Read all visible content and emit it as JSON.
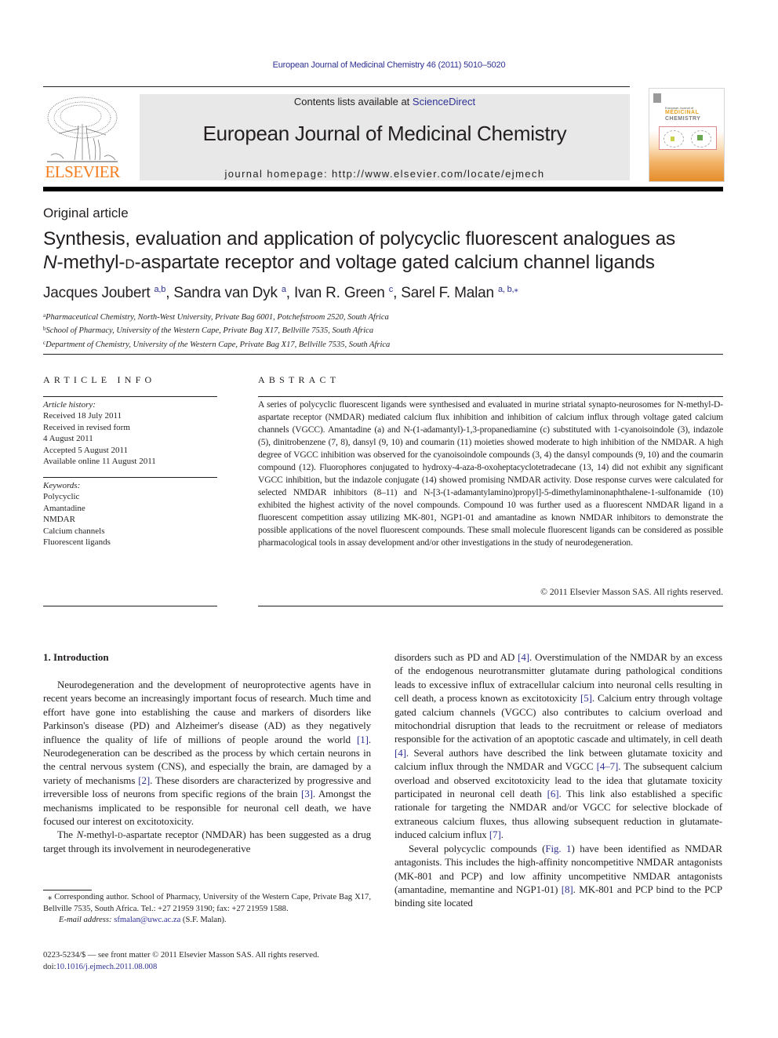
{
  "header": {
    "journal_ref": "European Journal of Medicinal Chemistry 46 (2011) 5010–5020",
    "contents_prefix": "Contents lists available at ",
    "contents_link": "ScienceDirect",
    "journal_title": "European Journal of Medicinal Chemistry",
    "homepage": "journal homepage: http://www.elsevier.com/locate/ejmech",
    "publisher_logo_text": "ELSEVIER",
    "cover": {
      "line1": "European Journal of",
      "line2": "MEDICINAL",
      "line3": "CHEMISTRY"
    }
  },
  "article": {
    "type": "Original article",
    "title_line1": "Synthesis, evaluation and application of polycyclic fluorescent analogues as",
    "title_line2_prefix": "N",
    "title_line2_mid": "-methyl-",
    "title_line2_d": "d",
    "title_line2_rest": "-aspartate receptor and voltage gated calcium channel ligands",
    "authors": [
      {
        "name": "Jacques Joubert",
        "sup": "a,b",
        "sep": ", "
      },
      {
        "name": "Sandra van Dyk",
        "sup": "a",
        "sep": ", "
      },
      {
        "name": "Ivan R. Green",
        "sup": "c",
        "sep": ", "
      },
      {
        "name": "Sarel F. Malan",
        "sup": "a, b,⁎",
        "sep": ""
      }
    ],
    "affiliations": [
      {
        "mark": "a",
        "text": "Pharmaceutical Chemistry, North-West University, Private Bag 6001, Potchefstroom 2520, South Africa"
      },
      {
        "mark": "b",
        "text": "School of Pharmacy, University of the Western Cape, Private Bag X17, Bellville 7535, South Africa"
      },
      {
        "mark": "c",
        "text": "Department of Chemistry, University of the Western Cape, Private Bag X17, Bellville 7535, South Africa"
      }
    ]
  },
  "article_info": {
    "heading": "ARTICLE INFO",
    "history_label": "Article history:",
    "history": [
      "Received 18 July 2011",
      "Received in revised form",
      "4 August 2011",
      "Accepted 5 August 2011",
      "Available online 11 August 2011"
    ],
    "keywords_label": "Keywords:",
    "keywords": [
      "Polycyclic",
      "Amantadine",
      "NMDAR",
      "Calcium channels",
      "Fluorescent ligands"
    ]
  },
  "abstract": {
    "heading": "ABSTRACT",
    "text": "A series of polycyclic fluorescent ligands were synthesised and evaluated in murine striatal synapto-neurosomes for N-methyl-D-aspartate receptor (NMDAR) mediated calcium flux inhibition and inhibition of calcium influx through voltage gated calcium channels (VGCC). Amantadine (a) and N-(1-adamantyl)-1,3-propanediamine (c) substituted with 1-cyanoisoindole (3), indazole (5), dinitrobenzene (7, 8), dansyl (9, 10) and coumarin (11) moieties showed moderate to high inhibition of the NMDAR. A high degree of VGCC inhibition was observed for the cyanoisoindole compounds (3, 4) the dansyl compounds (9, 10) and the coumarin compound (12). Fluorophores conjugated to hydroxy-4-aza-8-oxoheptacyclotetradecane (13, 14) did not exhibit any significant VGCC inhibition, but the indazole conjugate (14) showed promising NMDAR activity. Dose response curves were calculated for selected NMDAR inhibitors (8–11) and N-[3-(1-adamantylamino)propyl]-5-dimethylaminonaphthalene-1-sulfonamide (10) exhibited the highest activity of the novel compounds. Compound 10 was further used as a fluorescent NMDAR ligand in a fluorescent competition assay utilizing MK-801, NGP1-01 and amantadine as known NMDAR inhibitors to demonstrate the possible applications of the novel fluorescent compounds. These small molecule fluorescent ligands can be considered as possible pharmacological tools in assay development and/or other investigations in the study of neurodegeneration.",
    "copyright": "© 2011 Elsevier Masson SAS. All rights reserved."
  },
  "body": {
    "section_heading": "1.  Introduction",
    "left_p1": [
      "Neurodegeneration and the development of neuroprotective agents have in recent years become an increasingly important focus of research. Much time and effort have gone into establishing the cause and markers of disorders like Parkinson's disease (PD) and Alzheimer's disease (AD) as they negatively influence the quality of life of millions of people around the world ",
      "[1]",
      ". Neurodegeneration can be described as the process by which certain neurons in the central nervous system (CNS), and especially the brain, are damaged by a variety of mechanisms ",
      "[2]",
      ". These disorders are characterized by progressive and irreversible loss of neurons from specific regions of the brain ",
      "[3]",
      ". Amongst the mechanisms implicated to be responsible for neuronal cell death, we have focused our interest on excitotoxicity."
    ],
    "left_p2_a": "The ",
    "left_p2_n": "N",
    "left_p2_b": "-methyl-",
    "left_p2_d": "d",
    "left_p2_c": "-aspartate receptor (NMDAR) has been suggested as a drug target through its involvement in neurodegenerative",
    "right_p1": [
      "disorders such as PD and AD ",
      "[4]",
      ". Overstimulation of the NMDAR by an excess of the endogenous neurotransmitter glutamate during pathological conditions leads to excessive influx of extracellular calcium into neuronal cells resulting in cell death, a process known as excitotoxicity ",
      "[5]",
      ". Calcium entry through voltage gated calcium channels (VGCC) also contributes to calcium overload and mitochondrial disruption that leads to the recruitment or release of mediators responsible for the activation of an apoptotic cascade and ultimately, in cell death ",
      "[4]",
      ". Several authors have described the link between glutamate toxicity and calcium influx through the NMDAR and VGCC ",
      "[4–7]",
      ". The subsequent calcium overload and observed excitotoxicity lead to the idea that glutamate toxicity participated in neuronal cell death ",
      "[6]",
      ". This link also established a specific rationale for targeting the NMDAR and/or VGCC for selective blockade of extraneous calcium fluxes, thus allowing subsequent reduction in glutamate-induced calcium influx ",
      "[7]",
      "."
    ],
    "right_p2": [
      "Several polycyclic compounds (",
      "Fig. 1",
      ") have been identified as NMDAR antagonists. This includes the high-affinity noncompetitive NMDAR antagonists (MK-801 and PCP) and low affinity uncompetitive NMDAR antagonists (amantadine, memantine and NGP1-01) ",
      "[8]",
      ". MK-801 and PCP bind to the PCP binding site located"
    ]
  },
  "footnote": {
    "corresponding": "⁎ Corresponding author. School of Pharmacy, University of the Western Cape, Private Bag X17, Bellville 7535, South Africa. Tel.: +27 21959 3190; fax: +27 21959 1588.",
    "email_label": "E-mail address: ",
    "email": "sfmalan@uwc.ac.za",
    "email_suffix": " (S.F. Malan).",
    "front_matter": "0223-5234/$ — see front matter © 2011 Elsevier Masson SAS. All rights reserved.",
    "doi_label": "doi:",
    "doi": "10.1016/j.ejmech.2011.08.008"
  },
  "colors": {
    "link": "#2e3192",
    "elsevier_orange": "#f47d20",
    "banner_gray": "#e8e8e8"
  }
}
